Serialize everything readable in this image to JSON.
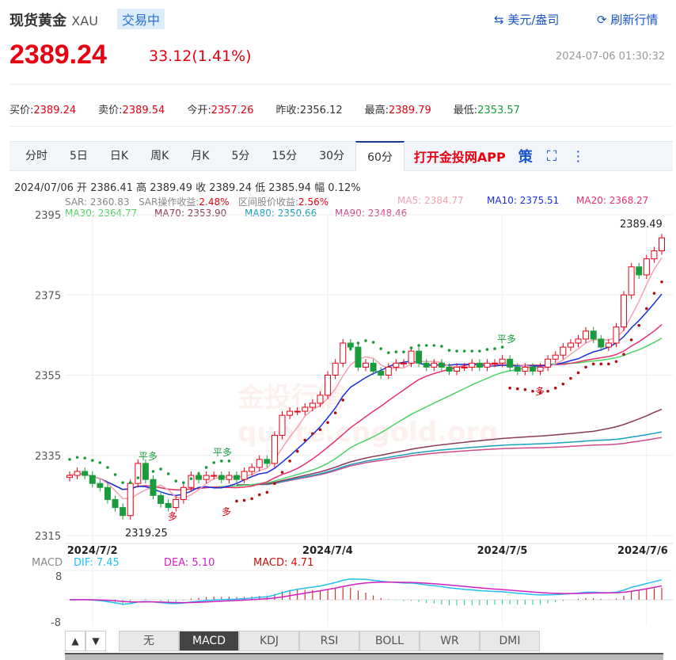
{
  "header": {
    "title": "现货黄金",
    "symbol": "XAU",
    "status": "交易中",
    "currency_label": "美元/盎司",
    "refresh_label": "刷新行情",
    "price": "2389.24",
    "change": "33.12(1.41%)",
    "datetime": "2024-07-06 01:30:32"
  },
  "quotes": [
    {
      "label": "买价:",
      "value": "2389.24",
      "color": "#e60012"
    },
    {
      "label": "卖价:",
      "value": "2389.54",
      "color": "#e60012"
    },
    {
      "label": "今开:",
      "value": "2357.26",
      "color": "#e60012"
    },
    {
      "label": "昨收:",
      "value": "2356.12",
      "color": "#333"
    },
    {
      "label": "最高:",
      "value": "2389.79",
      "color": "#e60012"
    },
    {
      "label": "最低:",
      "value": "2353.57",
      "color": "#1a9c3c"
    }
  ],
  "tabs": [
    "分时",
    "5日",
    "日K",
    "周K",
    "月K",
    "5分",
    "15分",
    "30分",
    "60分"
  ],
  "active_tab": "60分",
  "app_link": "打开金投网APP",
  "strategy_label": "策",
  "ohlc_line": "2024/07/06  开 2386.41  高 2389.49  收 2389.24  低 2385.94  幅 0.12%",
  "indicators": {
    "sar": "SAR: 2360.83",
    "sar_gain_label": "SAR操作收益:",
    "sar_gain": "2.48%",
    "range_label": "区间股价收益:",
    "range_gain": "2.56%",
    "ma5": "MA5: 2384.77",
    "ma10": "MA10: 2375.51",
    "ma20": "MA20: 2368.27",
    "ma30": "MA30: 2364.77",
    "ma70": "MA70: 2353.90",
    "ma80": "MA80: 2350.66",
    "ma90": "MA90: 2348.46"
  },
  "annotations": {
    "max": "2389.49",
    "min": "2319.25",
    "ping_duo": "平多",
    "duo": "多"
  },
  "watermark": "金投行情 quote.cngold.org",
  "macd": {
    "label": "MACD",
    "dif": "DIF: 7.45",
    "dea": "DEA: 5.10",
    "macd": "MACD: 4.71",
    "y_top": "8",
    "y_bottom": "-8"
  },
  "indicator_tabs": [
    "无",
    "MACD",
    "KDJ",
    "RSI",
    "BOLL",
    "WR",
    "DMI"
  ],
  "active_indicator": "MACD",
  "nav": {
    "up": "▲",
    "down": "▼"
  },
  "chart_data": {
    "type": "candlestick",
    "ylim": [
      2315,
      2395
    ],
    "yticks": [
      "2395",
      "2375",
      "2355",
      "2335",
      "2315"
    ],
    "xticks": [
      "2024/7/2",
      "2024/7/4",
      "2024/7/5",
      "2024/7/6"
    ],
    "xtick_index": [
      3,
      34,
      57,
      76
    ],
    "close": [
      2330,
      2331,
      2330,
      2328,
      2327,
      2324,
      2322,
      2320,
      2328,
      2333,
      2329,
      2325,
      2323,
      2322,
      2324,
      2327,
      2330,
      2329,
      2330,
      2330,
      2329,
      2330,
      2329,
      2331,
      2332,
      2334,
      2333,
      2340,
      2345,
      2346,
      2346,
      2347,
      2348,
      2350,
      2355,
      2358,
      2363,
      2362,
      2357,
      2358,
      2356,
      2355,
      2357,
      2358,
      2358,
      2361,
      2358,
      2357,
      2358,
      2357,
      2356,
      2357,
      2357,
      2358,
      2357,
      2358,
      2358,
      2359,
      2357,
      2356,
      2357,
      2356,
      2357,
      2359,
      2360,
      2362,
      2363,
      2364,
      2366,
      2364,
      2362,
      2363,
      2367,
      2375,
      2382,
      2380,
      2384,
      2386,
      2389.24
    ],
    "colors": {
      "up": "#e60012",
      "down": "#1a9c3c",
      "ma5": "#f4a0b4",
      "ma10": "#1a2fe0",
      "ma20": "#e8306a",
      "ma30": "#4cd264",
      "ma70": "#8b3a5a",
      "ma80": "#1aa0c0",
      "ma90": "#d04a8a",
      "dif": "#22c0ee",
      "dea": "#d020c0"
    }
  }
}
